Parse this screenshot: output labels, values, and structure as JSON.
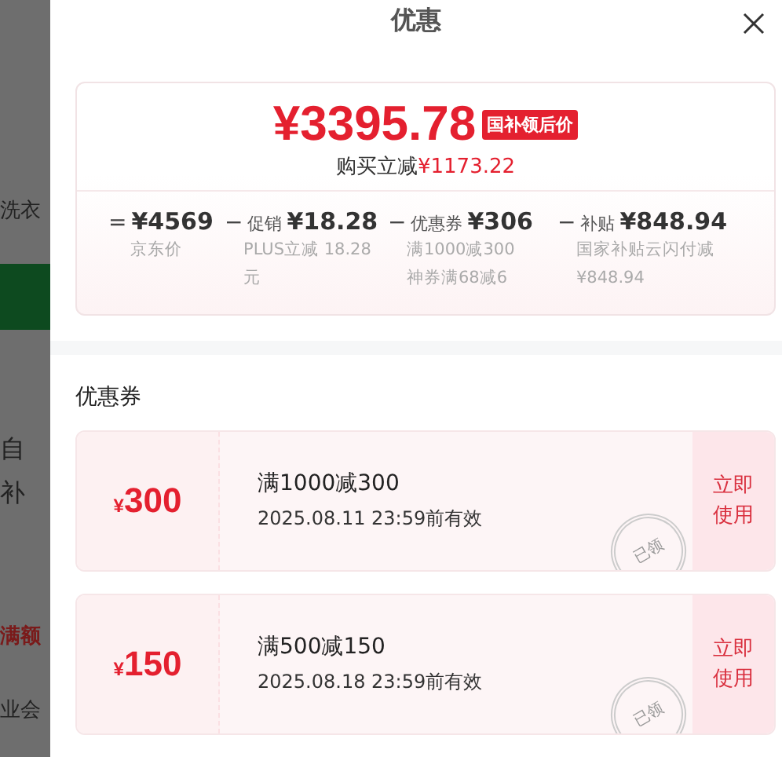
{
  "background_fragments": [
    {
      "text": "洗衣"
    },
    {
      "text": "自"
    },
    {
      "text": "补"
    },
    {
      "text": "满额",
      "kind": "red"
    },
    {
      "text": "业会"
    }
  ],
  "panel": {
    "title": "优惠"
  },
  "summary": {
    "price": "¥3395.78",
    "price_tag": "国补领后价",
    "saving_label": "购买立减",
    "saving_amount": "¥1173.22",
    "breakdown": [
      {
        "operator": "=",
        "amount": "¥4569",
        "notes": [
          "京东价"
        ]
      },
      {
        "operator": "−",
        "label": "促销",
        "amount": "¥18.28",
        "notes": [
          "PLUS立减 18.28元"
        ]
      },
      {
        "operator": "−",
        "label": "优惠券",
        "amount": "¥306",
        "notes": [
          "满1000减300",
          "神券满68减6"
        ]
      },
      {
        "operator": "−",
        "label": "补贴",
        "amount": "¥848.94",
        "notes": [
          "国家补贴云闪付减¥848.94"
        ]
      }
    ]
  },
  "coupons_section": {
    "heading": "优惠券",
    "coupons": [
      {
        "currency": "¥",
        "amount": "300",
        "condition": "满1000减300",
        "validity": "2025.08.11 23:59前有效",
        "stamp": "已领",
        "button": "立即使用"
      },
      {
        "currency": "¥",
        "amount": "150",
        "condition": "满500减150",
        "validity": "2025.08.18 23:59前有效",
        "stamp": "已领",
        "button": "立即使用"
      }
    ]
  }
}
